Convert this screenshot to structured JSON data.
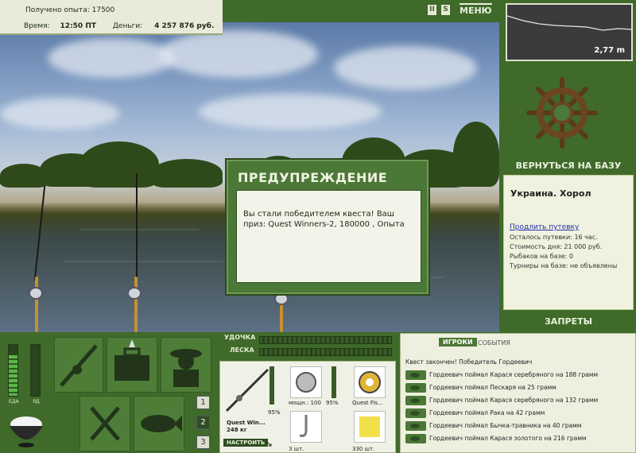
{
  "header": {
    "xp_label": "Получено опыта:",
    "xp_value": "17500",
    "time_label": "Время:",
    "time_value": "12:50 ПТ",
    "money_label": "Деньги:",
    "money_value": "4 257 876 руб.",
    "pause_glyph": "II",
    "sound_glyph": "S",
    "menu_label": "МЕНЮ"
  },
  "depth": {
    "value": "2,77 m"
  },
  "right_panel": {
    "back_to_base": "ВЕРНУТЬСЯ НА БАЗУ",
    "location": "Украина. Хорол",
    "prolong_link": "Продлить путевку",
    "stats": [
      "Осталось путевки: 16 час.",
      "Стоимость дня: 21 000 руб.",
      "Рыбаков на базе: 0",
      "Турниры на базе: не объявлены"
    ],
    "bans_label": "ЗАПРЕТЫ"
  },
  "dialog": {
    "title": "ПРЕДУПРЕЖДЕНИЕ",
    "message": "Вы стали победителем квеста! Ваш приз: Quest Winners-2, 180000 , Опыта"
  },
  "meters": {
    "food_label": "ЕДА",
    "poison_label": "ЯД",
    "food_level": 0.8,
    "poison_level": 0.0
  },
  "rod_selector": [
    "1",
    "2",
    "3"
  ],
  "tackle": {
    "rods_label": "УДОЧКА",
    "line_label": "ЛЕСКА",
    "rod_name": "Quest Win...",
    "rod_weight": "248 кг",
    "rod_pct": "95%",
    "reel_power": "мощн.: 100",
    "reel_pct": "95%",
    "line_name": "Quest Fis...",
    "hooks_count": "3 шт.",
    "bait_count": "330 шт.",
    "setup_button": "НАСТРОИТЬ"
  },
  "log": {
    "tab_players": "ИГРОКИ",
    "tab_events": "СОБЫТИЯ",
    "lines": [
      "Квест закончен! Победитель Гордеевич",
      "Гордеевич поймал Карася серебряного на 188 грамм",
      "Гордеевич поймал Пескаря на 25 грамм",
      "Гордеевич поймал Карася серебряного на 132 грамм",
      "Гордеевич поймал Рака на 42 грамм",
      "Гордеевич поймал Бычка-травника на 40 грамм",
      "Гордеевич поймал Карася золотого на 216 грамм"
    ]
  }
}
